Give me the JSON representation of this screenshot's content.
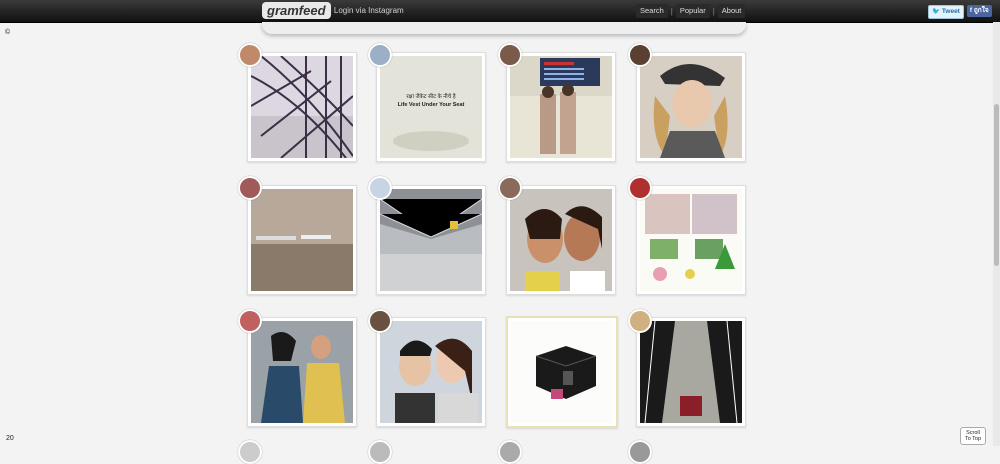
{
  "topbar": {
    "logo": "gramfeed",
    "login_link": "- Login via Instagram",
    "nav": [
      "Search",
      "Popular",
      "About"
    ],
    "share_tweet": "Tweet",
    "share_facebook": "ถูกใจ"
  },
  "side": {
    "top_mark": "©",
    "bottom_count": "20"
  },
  "cards": [
    {
      "caption": ""
    },
    {
      "caption_line1": "रक्षा जैकेट सीट के नीचे है",
      "caption_line2": "Life Vest Under Your Seat"
    },
    {
      "caption": ""
    },
    {
      "caption": ""
    },
    {
      "caption": ""
    },
    {
      "caption": ""
    },
    {
      "caption": ""
    },
    {
      "caption": ""
    },
    {
      "caption": ""
    },
    {
      "caption": ""
    },
    {
      "caption": ""
    },
    {
      "caption": ""
    }
  ],
  "scroll_to_top": {
    "line1": "Scroll",
    "line2": "To Top"
  }
}
